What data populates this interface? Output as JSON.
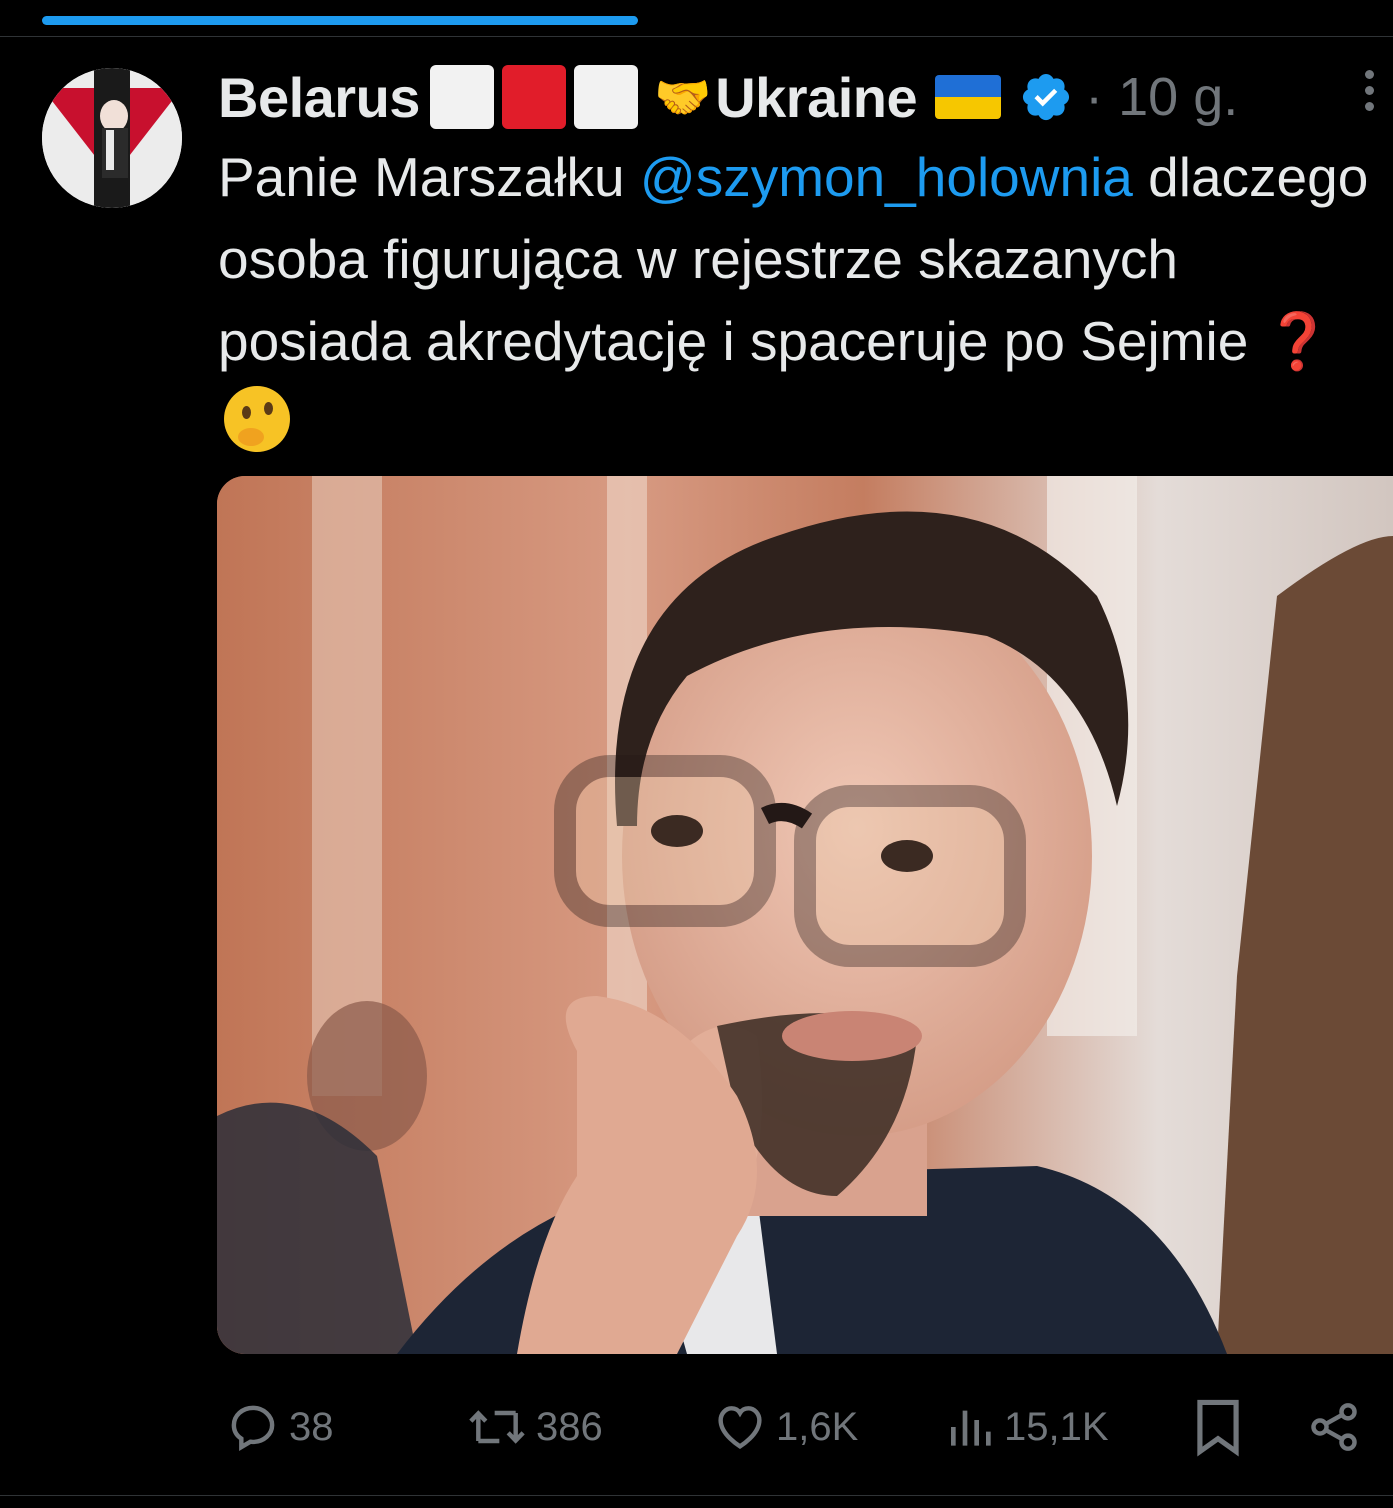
{
  "author": {
    "name": "Belarus",
    "name_suffix": "Ukraine",
    "time": "· 10 g."
  },
  "tweet": {
    "text_before": "Panie Marszałku ",
    "mention": "@szymon_holownia",
    "text_after": " dlaczego osoba figurująca w rejestrze skazanych posiada akredytację i spaceruje po Sejmie ",
    "emoji_question": "❓"
  },
  "actions": {
    "replies": "38",
    "reposts": "386",
    "likes": "1,6K",
    "views": "15,1K"
  },
  "colors": {
    "accent": "#1d9bf0",
    "muted": "#71767b",
    "background": "#000000"
  }
}
